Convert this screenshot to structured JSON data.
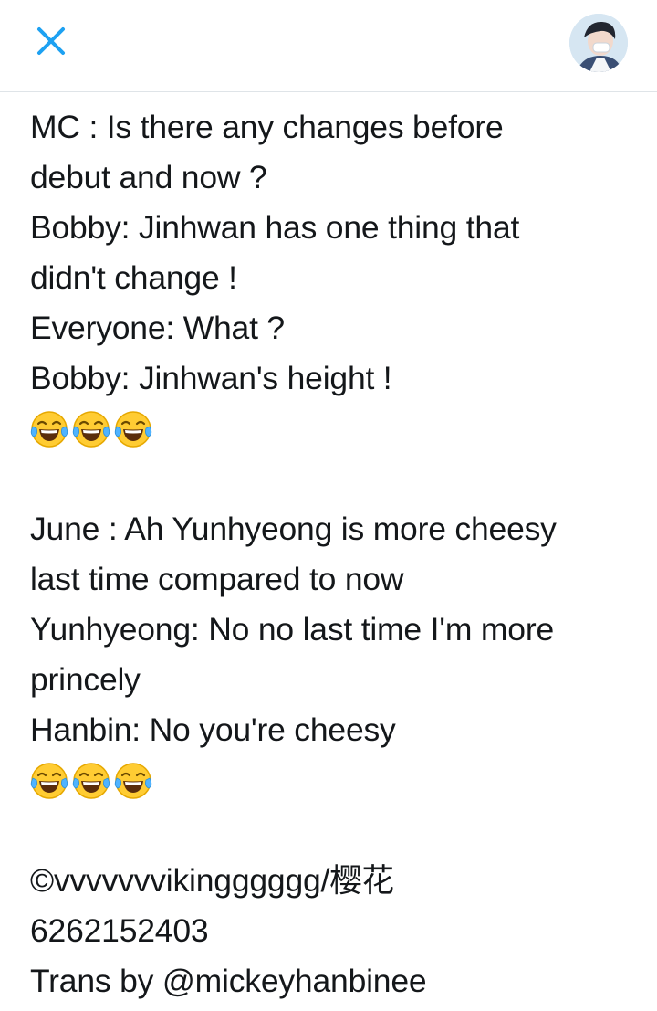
{
  "header": {
    "close_icon": "close-icon",
    "avatar": "avatar"
  },
  "post": {
    "lines": [
      "MC : Is there any changes before",
      "debut and now ?",
      "Bobby: Jinhwan has one thing that",
      "didn't change !",
      "Everyone: What ?",
      "Bobby: Jinhwan's height !",
      "June : Ah Yunhyeong is more cheesy",
      "last time compared to now",
      "Yunhyeong: No no last time I'm more",
      "princely",
      "Hanbin: No you're cheesy",
      "©vvvvvvvikingggggg/樱花",
      "6262152403",
      "Trans by @mickeyhanbinee"
    ]
  },
  "colors": {
    "accent": "#1da1f2",
    "text": "#14171a",
    "divider": "#dfe4e8"
  }
}
